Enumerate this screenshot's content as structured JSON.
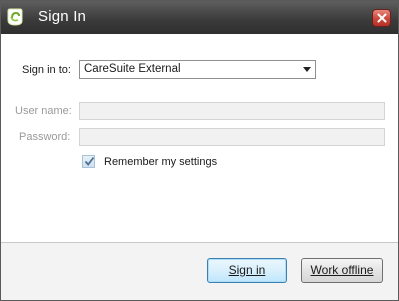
{
  "window": {
    "title": "Sign In",
    "app_icon": "caresuite-logo-icon",
    "close_icon": "close-icon"
  },
  "form": {
    "sign_in_to_label": "Sign in to:",
    "sign_in_to_value": "CareSuite External",
    "username_label": "User name:",
    "username_value": "",
    "password_label": "Password:",
    "password_value": "",
    "remember_label": "Remember my settings",
    "remember_checked": true
  },
  "buttons": {
    "sign_in_label": "Sign in",
    "work_offline_label": "Work offline"
  },
  "colors": {
    "titlebar": "#3a3a3a",
    "close_button": "#c9463a",
    "primary_button_border": "#3c7fb1"
  }
}
